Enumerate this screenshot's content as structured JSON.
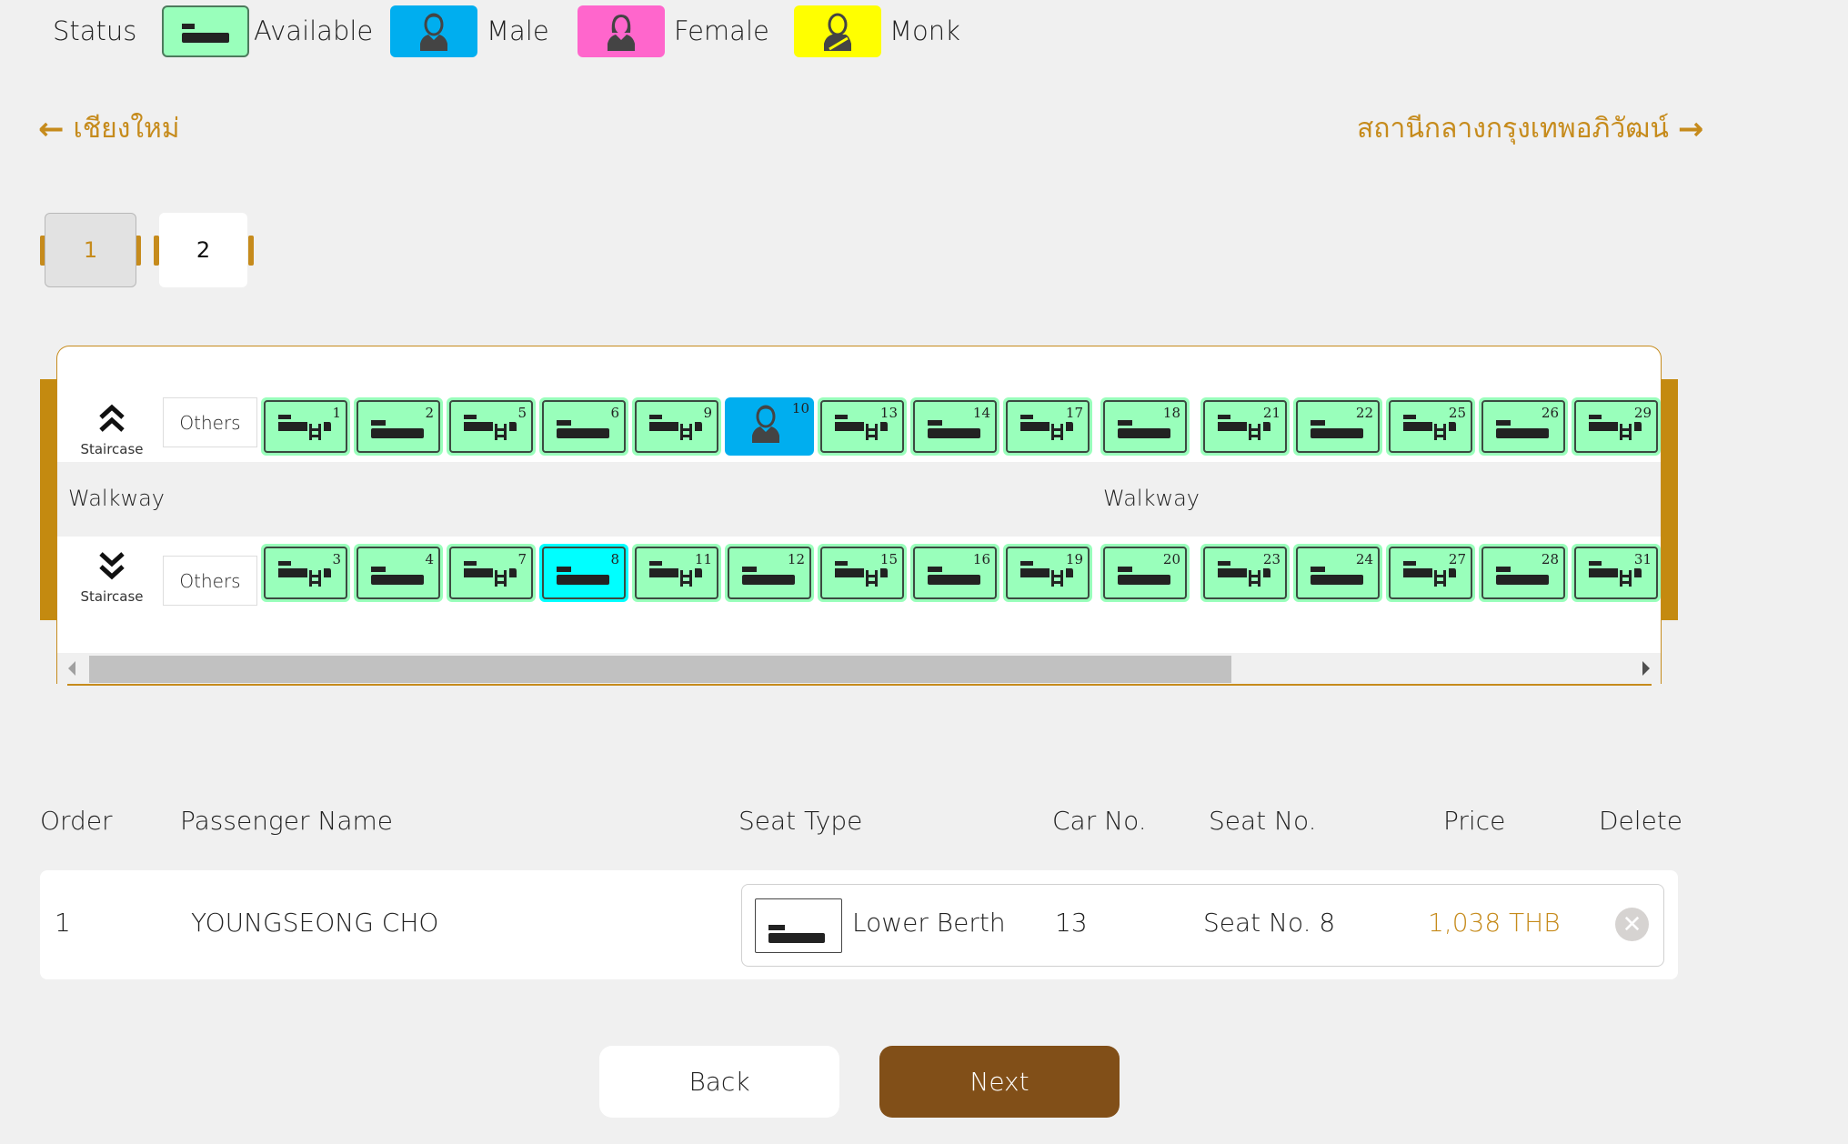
{
  "legend": {
    "title": "Status",
    "items": [
      {
        "key": "available",
        "label": "Available",
        "color": "#99ffbb",
        "icon": "lower-berth-icon"
      },
      {
        "key": "male",
        "label": "Male",
        "color": "#00aeef",
        "icon": "male-person-icon"
      },
      {
        "key": "female",
        "label": "Female",
        "color": "#ff66cc",
        "icon": "female-person-icon"
      },
      {
        "key": "monk",
        "label": "Monk",
        "color": "#ffff00",
        "icon": "monk-person-icon"
      }
    ]
  },
  "route": {
    "origin": "เชียงใหม่",
    "destination": "สถานีกลางกรุงเทพอภิวัฒน์"
  },
  "car_tabs": [
    {
      "label": "1",
      "active": true
    },
    {
      "label": "2",
      "active": false
    }
  ],
  "car_map": {
    "staircase_label": "Staircase",
    "others_label": "Others",
    "walkway_label": "Walkway",
    "top_row": [
      {
        "num": "1",
        "type": "upper",
        "status": "available"
      },
      {
        "num": "2",
        "type": "lower",
        "status": "available"
      },
      {
        "num": "5",
        "type": "upper",
        "status": "available"
      },
      {
        "num": "6",
        "type": "lower",
        "status": "available"
      },
      {
        "num": "9",
        "type": "upper",
        "status": "available"
      },
      {
        "num": "10",
        "type": "upper",
        "status": "male"
      },
      {
        "num": "13",
        "type": "upper",
        "status": "available"
      },
      {
        "num": "14",
        "type": "lower",
        "status": "available"
      },
      {
        "num": "17",
        "type": "upper",
        "status": "available"
      },
      {
        "num": "18",
        "type": "lower",
        "status": "available"
      },
      {
        "num": "21",
        "type": "upper",
        "status": "available"
      },
      {
        "num": "22",
        "type": "lower",
        "status": "available"
      },
      {
        "num": "25",
        "type": "upper",
        "status": "available"
      },
      {
        "num": "26",
        "type": "lower",
        "status": "available"
      },
      {
        "num": "29",
        "type": "upper",
        "status": "available"
      }
    ],
    "bottom_row": [
      {
        "num": "3",
        "type": "upper",
        "status": "available"
      },
      {
        "num": "4",
        "type": "lower",
        "status": "available"
      },
      {
        "num": "7",
        "type": "upper",
        "status": "available"
      },
      {
        "num": "8",
        "type": "lower",
        "status": "selected"
      },
      {
        "num": "11",
        "type": "upper",
        "status": "available"
      },
      {
        "num": "12",
        "type": "lower",
        "status": "available"
      },
      {
        "num": "15",
        "type": "upper",
        "status": "available"
      },
      {
        "num": "16",
        "type": "lower",
        "status": "available"
      },
      {
        "num": "19",
        "type": "upper",
        "status": "available"
      },
      {
        "num": "20",
        "type": "lower",
        "status": "available"
      },
      {
        "num": "23",
        "type": "upper",
        "status": "available"
      },
      {
        "num": "24",
        "type": "lower",
        "status": "available"
      },
      {
        "num": "27",
        "type": "upper",
        "status": "available"
      },
      {
        "num": "28",
        "type": "lower",
        "status": "available"
      },
      {
        "num": "31",
        "type": "upper",
        "status": "available"
      }
    ],
    "status_colors": {
      "available": "#99ffbb",
      "selected": "#00ffff",
      "male": "#00aeef"
    }
  },
  "table": {
    "headers": {
      "order": "Order",
      "name": "Passenger Name",
      "seat_type": "Seat Type",
      "car_no": "Car No.",
      "seat_no": "Seat No.",
      "price": "Price",
      "delete": "Delete"
    },
    "rows": [
      {
        "order": "1",
        "name": "YOUNGSEONG CHO",
        "seat_type": "Lower Berth",
        "car_no": "13",
        "seat_no": "Seat No. 8",
        "price": "1,038 THB"
      }
    ]
  },
  "buttons": {
    "back": "Back",
    "next": "Next"
  }
}
